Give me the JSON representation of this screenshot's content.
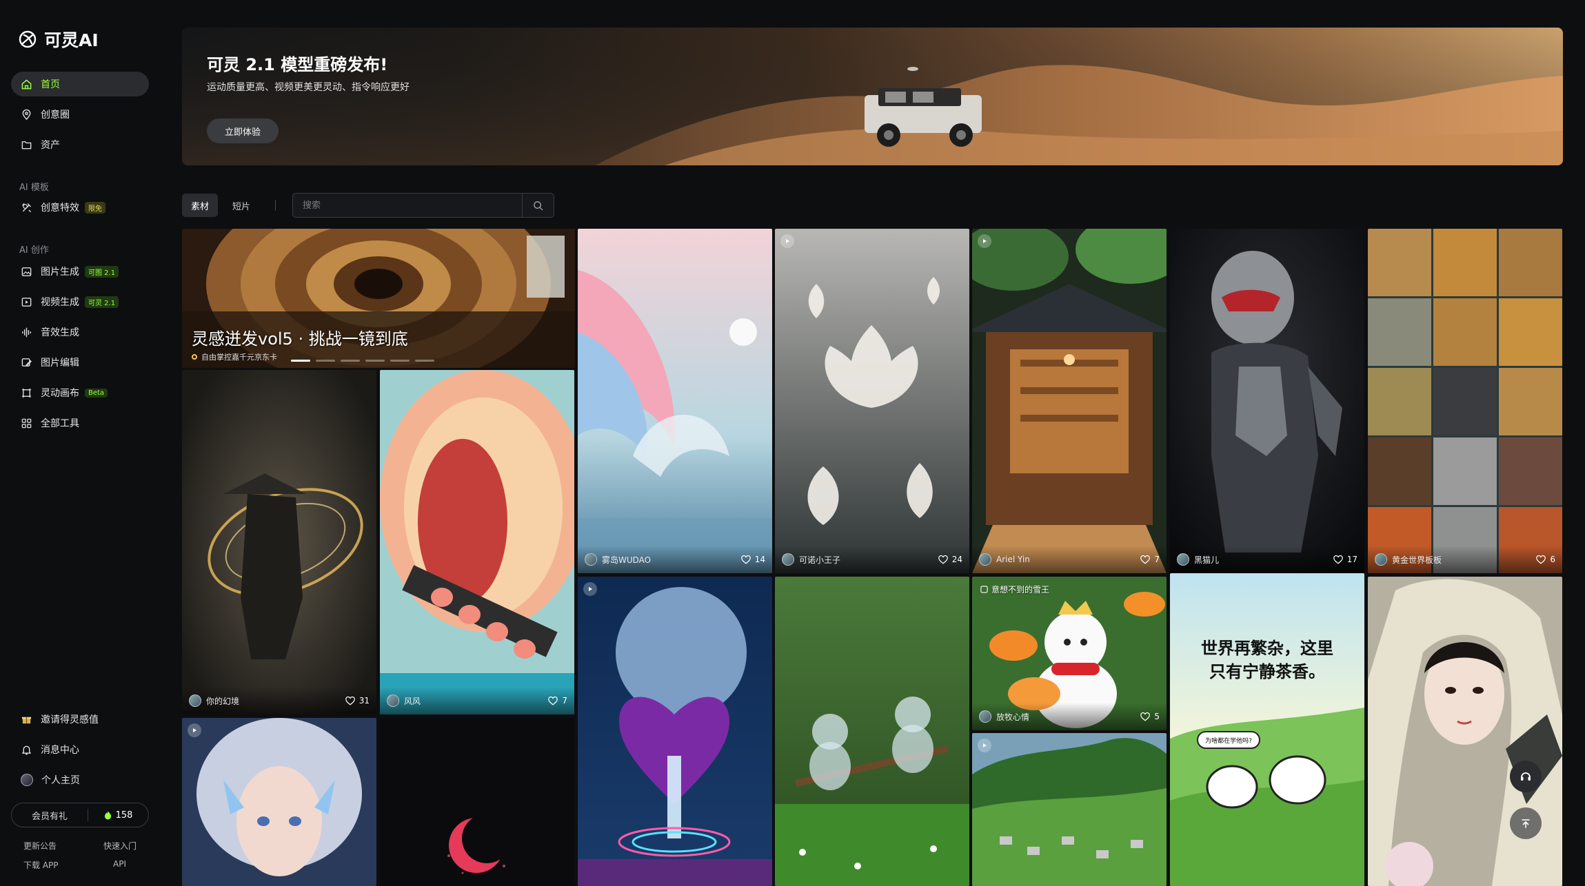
{
  "app": {
    "name": "可灵AI"
  },
  "sidebar": {
    "main": [
      {
        "label": "首页",
        "icon": "home-icon",
        "active": true
      },
      {
        "label": "创意圈",
        "icon": "compass-icon"
      },
      {
        "label": "资产",
        "icon": "folder-icon"
      }
    ],
    "section_templates": "AI 模板",
    "templates": [
      {
        "label": "创意特效",
        "tag": "限免"
      }
    ],
    "section_create": "AI 创作",
    "create": [
      {
        "label": "图片生成",
        "tag": "可图 2.1"
      },
      {
        "label": "视频生成",
        "tag": "可灵 2.1"
      },
      {
        "label": "音效生成",
        "tag": ""
      },
      {
        "label": "图片编辑",
        "tag": ""
      },
      {
        "label": "灵动画布",
        "tag": "Beta"
      },
      {
        "label": "全部工具",
        "tag": ""
      }
    ],
    "bottom": [
      {
        "label": "邀请得灵感值"
      },
      {
        "label": "消息中心"
      },
      {
        "label": "个人主页"
      }
    ],
    "member": {
      "label": "会员有礼",
      "points": "158"
    },
    "footer": {
      "notice": "更新公告",
      "quick": "快速入门",
      "download": "下载 APP",
      "api": "API"
    }
  },
  "banner": {
    "title": "可灵 2.1 模型重磅发布!",
    "subtitle": "运动质量更高、视频更美更灵动、指令响应更好",
    "cta": "立即体验"
  },
  "filters": {
    "tabs": [
      "素材",
      "短片"
    ],
    "search_placeholder": "搜索"
  },
  "feature": {
    "title": "灵感迸发vol5 · 挑战一镜到底",
    "subtitle": "自由掌控嘉千元京东卡"
  },
  "cards": [
    {
      "id": "c1",
      "author": "你的幻境",
      "likes": "31"
    },
    {
      "id": "c2",
      "author": "风风",
      "likes": "7"
    },
    {
      "id": "c3",
      "author": "雾岛WUDAO",
      "likes": "14"
    },
    {
      "id": "c4",
      "author": "可诺小王子",
      "likes": "24"
    },
    {
      "id": "c5",
      "author": "Ariel Yin",
      "likes": "7"
    },
    {
      "id": "c6",
      "author": "黑猫儿",
      "likes": "17"
    },
    {
      "id": "c7",
      "author": "黄金世界板板",
      "likes": "6"
    },
    {
      "id": "c8",
      "author": "放牧心情",
      "likes": "5",
      "tag": "意想不到的雪王"
    }
  ],
  "comic": {
    "line1": "世界再繁杂，这里",
    "line2": "只有宁静茶香。",
    "bubble": "为啥都在学他吗?"
  }
}
